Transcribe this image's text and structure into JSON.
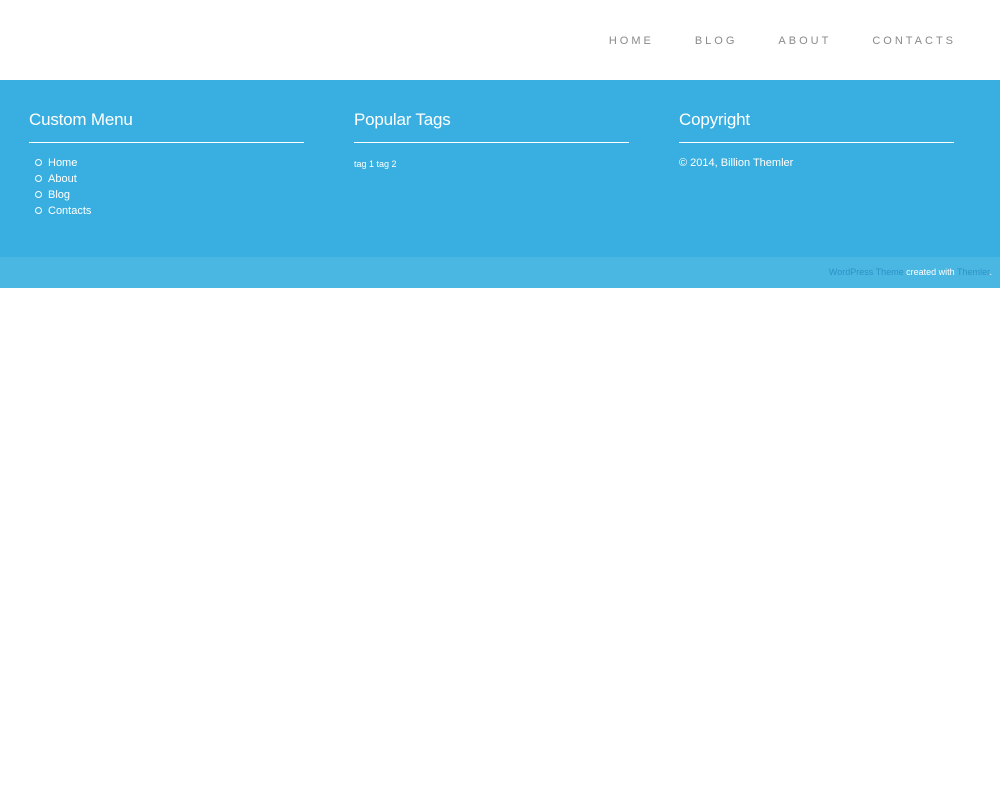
{
  "nav": {
    "items": [
      {
        "label": "HOME"
      },
      {
        "label": "BLOG"
      },
      {
        "label": "ABOUT"
      },
      {
        "label": "CONTACTS"
      }
    ]
  },
  "footer": {
    "custom_menu": {
      "title": "Custom Menu",
      "items": [
        {
          "label": "Home"
        },
        {
          "label": "About"
        },
        {
          "label": "Blog"
        },
        {
          "label": "Contacts"
        }
      ]
    },
    "popular_tags": {
      "title": "Popular Tags",
      "tags": [
        {
          "label": "tag 1"
        },
        {
          "label": "tag 2"
        }
      ]
    },
    "copyright": {
      "title": "Copyright",
      "text": "© 2014, Billion Themler"
    }
  },
  "credits": {
    "link1": "WordPress Theme",
    "middle": " created with ",
    "link2": "Themler",
    "end": "."
  },
  "colors": {
    "footer_bg": "#38afe0",
    "bottom_bar_bg": "#4ab6e2",
    "nav_text": "#8a8a8a",
    "credit_link": "#2c93c4"
  }
}
